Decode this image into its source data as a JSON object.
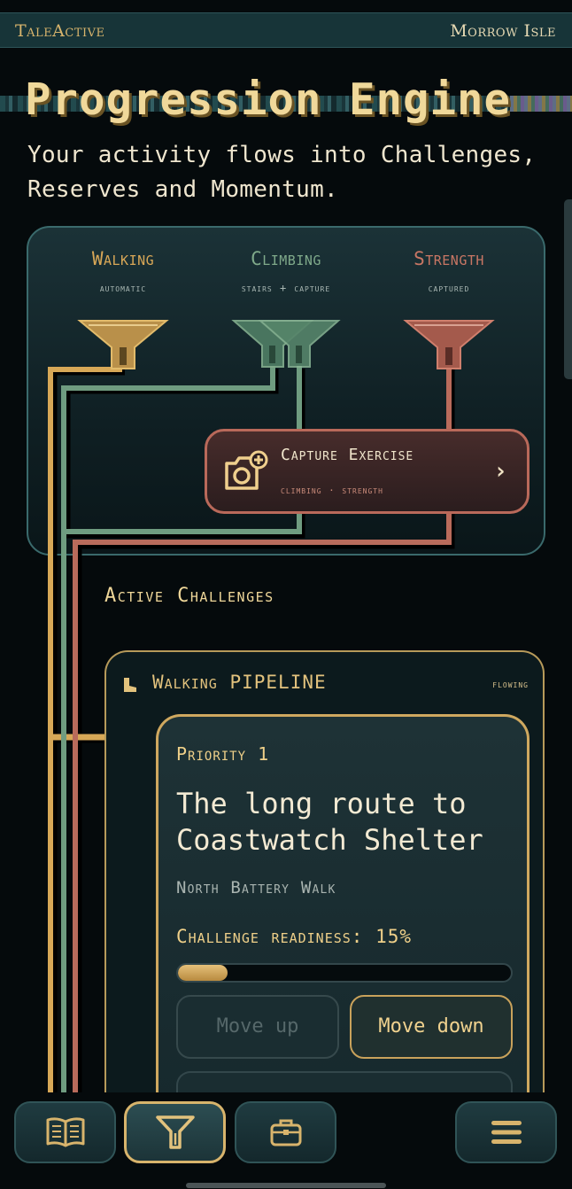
{
  "header": {
    "brand": "TaleActive",
    "location": "Morrow Isle"
  },
  "page": {
    "title": "Progression Engine",
    "subtitle": "Your activity flows into Challenges, Reserves and Momentum."
  },
  "sources": [
    {
      "name": "Walking",
      "mode": "automatic",
      "color": "#d8a757"
    },
    {
      "name": "Climbing",
      "mode": "stairs + capture",
      "color": "#7fa98a"
    },
    {
      "name": "Strength",
      "mode": "captured",
      "color": "#c87664"
    }
  ],
  "capture": {
    "label": "Capture Exercise",
    "sub": "climbing · strength",
    "chevron": "›",
    "icon": "camera-plus-icon"
  },
  "challenges": {
    "section_title": "Active Challenges",
    "pipeline": {
      "name_prefix": "Walking",
      "name_suffix": "PIPELINE",
      "status": "flowing",
      "icon": "boot-icon"
    },
    "card": {
      "priority": "Priority 1",
      "title": "The long route to Coastwatch Shelter",
      "location": "North Battery Walk",
      "readiness_label": "Challenge readiness:",
      "readiness_value": "15%",
      "readiness_fraction": 0.15,
      "move_up": "Move up",
      "move_down": "Move down"
    }
  },
  "nav": [
    {
      "icon": "book-icon",
      "active": false
    },
    {
      "icon": "funnel-icon",
      "active": true
    },
    {
      "icon": "briefcase-icon",
      "active": false
    },
    {
      "icon": "menu-icon",
      "active": false
    }
  ],
  "colors": {
    "gold": "#d8b46c",
    "green": "#7fa98a",
    "red": "#c87664",
    "panel_border": "#3a6a6c"
  }
}
